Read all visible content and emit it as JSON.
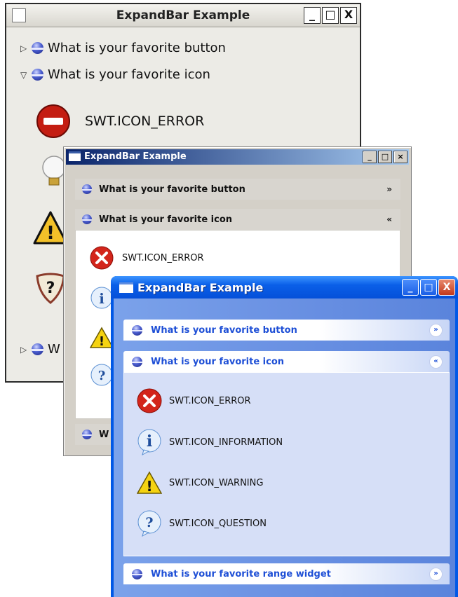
{
  "gtk_window": {
    "title": "ExpandBar Example",
    "buttons": [
      "_",
      "□",
      "X"
    ],
    "bars": [
      "What is your favorite button",
      "What is your favorite icon",
      "W"
    ],
    "icons": [
      {
        "icon": "error-icon",
        "label": "SWT.ICON_ERROR"
      }
    ]
  },
  "classic_window": {
    "title": "ExpandBar Example",
    "buttons": [
      "_",
      "□",
      "×"
    ],
    "bars": [
      "What is your favorite button",
      "What is your favorite icon",
      "W"
    ],
    "chevrons": [
      "»",
      "«"
    ],
    "icons": [
      {
        "icon": "error-icon",
        "label": "SWT.ICON_ERROR"
      }
    ]
  },
  "xp_window": {
    "title": "ExpandBar Example",
    "buttons": [
      "_",
      "□",
      "X"
    ],
    "bars": [
      "What is your favorite button",
      "What is your favorite icon",
      "What is your favorite range widget"
    ],
    "chevrons": [
      "»",
      "«",
      "»"
    ],
    "icons": [
      {
        "icon": "error-icon",
        "label": "SWT.ICON_ERROR"
      },
      {
        "icon": "information-icon",
        "label": "SWT.ICON_INFORMATION"
      },
      {
        "icon": "warning-icon",
        "label": "SWT.ICON_WARNING"
      },
      {
        "icon": "question-icon",
        "label": "SWT.ICON_QUESTION"
      }
    ]
  }
}
